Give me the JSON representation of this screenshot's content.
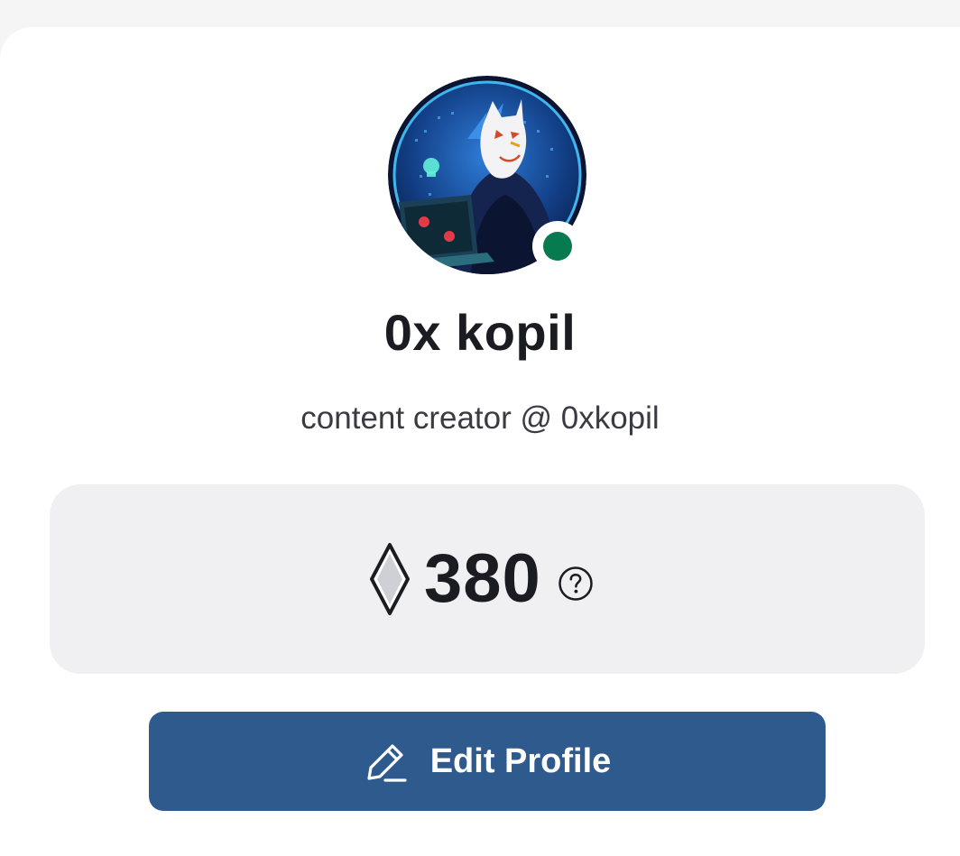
{
  "profile": {
    "display_name": "0x kopil",
    "bio": "content creator @ 0xkopil",
    "avatar_icon": "masked-hacker-avatar",
    "status": "online"
  },
  "points": {
    "value": "380",
    "icon": "diamond-icon",
    "help_icon": "question-circle-icon"
  },
  "actions": {
    "edit_profile_label": "Edit Profile",
    "edit_icon": "pencil-icon"
  },
  "colors": {
    "page_bg": "#f5f5f6",
    "card_bg": "#ffffff",
    "points_bg": "#f0f0f2",
    "status_online": "#087a4f",
    "button_bg": "#2f5a8d",
    "text_primary": "#1b1b22",
    "text_secondary": "#3a3a42"
  }
}
